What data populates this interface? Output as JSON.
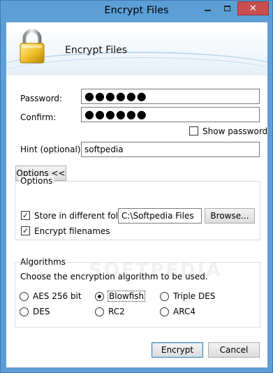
{
  "window": {
    "title": "Encrypt Files"
  },
  "banner": {
    "title": "Encrypt Files",
    "icon": "padlock-icon"
  },
  "password": {
    "label": "Password:",
    "value": "●●●●●●"
  },
  "confirm": {
    "label": "Confirm:",
    "value": "●●●●●●"
  },
  "show_password": {
    "label": "Show password",
    "checked": false
  },
  "hint": {
    "label": "Hint (optional):",
    "value": "softpedia"
  },
  "options_button": "Options <<",
  "options_group": {
    "title": "Options",
    "store_folder": {
      "label": "Store in different folder:",
      "checked": true,
      "path": "C:\\Softpedia Files",
      "browse": "Browse..."
    },
    "encrypt_filenames": {
      "label": "Encrypt filenames",
      "checked": true
    }
  },
  "algorithms": {
    "title": "Algorithms",
    "description": "Choose the encryption algorithm to be used.",
    "items": [
      {
        "label": "AES 256 bit",
        "selected": false
      },
      {
        "label": "Blowfish",
        "selected": true
      },
      {
        "label": "Triple DES",
        "selected": false
      },
      {
        "label": "DES",
        "selected": false
      },
      {
        "label": "RC2",
        "selected": false
      },
      {
        "label": "ARC4",
        "selected": false
      }
    ]
  },
  "watermark": "SOFTPEDIA",
  "footer": {
    "encrypt": "Encrypt",
    "cancel": "Cancel"
  },
  "colors": {
    "frame": "#5c9fd6",
    "close_button": "#c74f4f",
    "default_button_border": "#3c7fb1"
  }
}
